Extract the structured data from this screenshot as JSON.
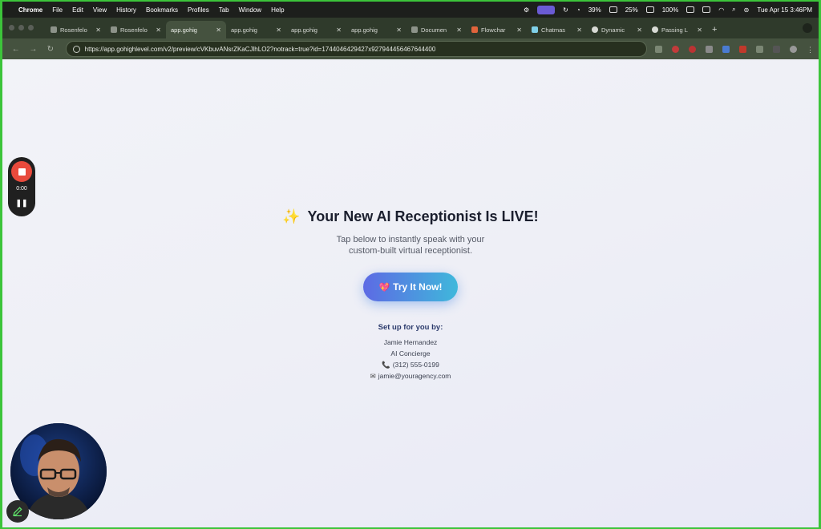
{
  "menubar": {
    "app_name": "Chrome",
    "items": [
      "File",
      "Edit",
      "View",
      "History",
      "Bookmarks",
      "Profiles",
      "Tab",
      "Window",
      "Help"
    ],
    "cpu": "39%",
    "mem": "25%",
    "battery": "100%",
    "datetime": "Tue Apr 15  3:46PM"
  },
  "tabs": [
    {
      "label": "Rosenfelo",
      "active": false
    },
    {
      "label": "Rosenfelo",
      "active": false
    },
    {
      "label": "app.gohig",
      "active": true
    },
    {
      "label": "app.gohig",
      "active": false
    },
    {
      "label": "app.gohig",
      "active": false
    },
    {
      "label": "app.gohig",
      "active": false
    },
    {
      "label": "Documen",
      "active": false
    },
    {
      "label": "Flowchar",
      "active": false
    },
    {
      "label": "Chatmas",
      "active": false
    },
    {
      "label": "Dynamic",
      "active": false
    },
    {
      "label": "Passing L",
      "active": false
    }
  ],
  "toolbar": {
    "url": "https://app.gohighlevel.com/v2/preview/cVKbuvANsrZKaCJlhLO2?notrack=true?id=1744046429427x927944456467644400"
  },
  "page": {
    "headline_icon": "✨",
    "headline": "Your New AI Receptionist Is LIVE!",
    "subtitle_line1": "Tap below to instantly speak with your",
    "subtitle_line2": "custom-built virtual receptionist.",
    "cta_icon": "💖",
    "cta_label": "Try It Now!",
    "setup_title": "Set up for you by:",
    "contact_name": "Jamie Hernandez",
    "contact_title": "AI Concierge",
    "contact_phone": "(312) 555-0199",
    "contact_email": "jamie@youragency.com"
  },
  "recorder": {
    "time": "0:00"
  }
}
